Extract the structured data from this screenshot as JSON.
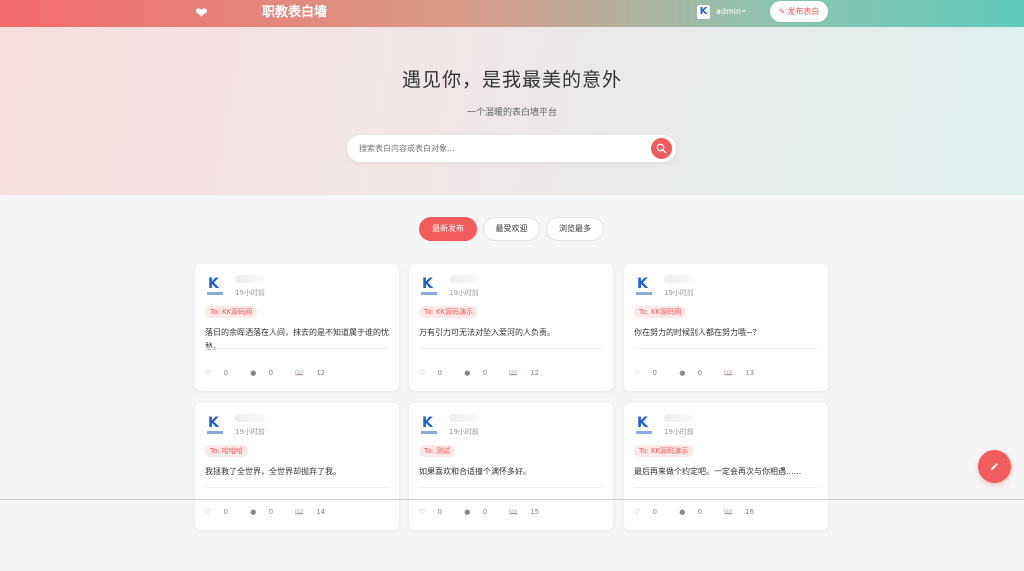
{
  "header": {
    "logo_icon": "heart-icon",
    "title": "职教表白墙",
    "user": {
      "avatar_letter": "K",
      "name": "admin",
      "caret_icon": "chevron-down-icon"
    },
    "publish_button": {
      "icon": "pencil-icon",
      "label": "发布表白"
    }
  },
  "hero": {
    "title": "遇见你，是我最美的意外",
    "subtitle": "一个温暖的表白墙平台",
    "search": {
      "placeholder": "搜索表白内容或表白对象...",
      "value": "",
      "icon": "search-icon"
    }
  },
  "tabs": [
    {
      "label": "最新发布",
      "active": true
    },
    {
      "label": "最受欢迎",
      "active": false
    },
    {
      "label": "浏览最多",
      "active": false
    }
  ],
  "posts": [
    {
      "avatar_letter": "K",
      "time": "19小时前",
      "to": "To: KK源码网",
      "content": "落日的余晖洒落在人间，抹去的是不知道属于谁的忧愁。",
      "likes": "0",
      "comments": "0",
      "views": "12"
    },
    {
      "avatar_letter": "K",
      "time": "19小时前",
      "to": "To: KK源码演示",
      "content": "万有引力可无法对坠入爱河的人负责。",
      "likes": "0",
      "comments": "0",
      "views": "12"
    },
    {
      "avatar_letter": "K",
      "time": "19小时前",
      "to": "To: KK源码网",
      "content": "你在努力的时候别人都在努力哦~？",
      "likes": "0",
      "comments": "0",
      "views": "13"
    },
    {
      "avatar_letter": "K",
      "time": "19小时前",
      "to": "To: 哈哈哈",
      "content": "我拯救了全世界，全世界却抛弃了我。",
      "likes": "0",
      "comments": "0",
      "views": "14"
    },
    {
      "avatar_letter": "K",
      "time": "19小时前",
      "to": "To: 测试",
      "content": "如果喜欢和合适撞个满怀多好。",
      "likes": "0",
      "comments": "0",
      "views": "15"
    },
    {
      "avatar_letter": "K",
      "time": "19小时前",
      "to": "To: KK源码演示",
      "content": "最后再来做个约定吧。一定会再次与你相遇......",
      "likes": "0",
      "comments": "0",
      "views": "16"
    }
  ],
  "fab": {
    "icon": "pencil-icon"
  },
  "colors": {
    "accent": "#f25c5c",
    "header_start": "#f46b6e",
    "header_end": "#5fcab9",
    "tag_bg": "#fde8e8"
  }
}
